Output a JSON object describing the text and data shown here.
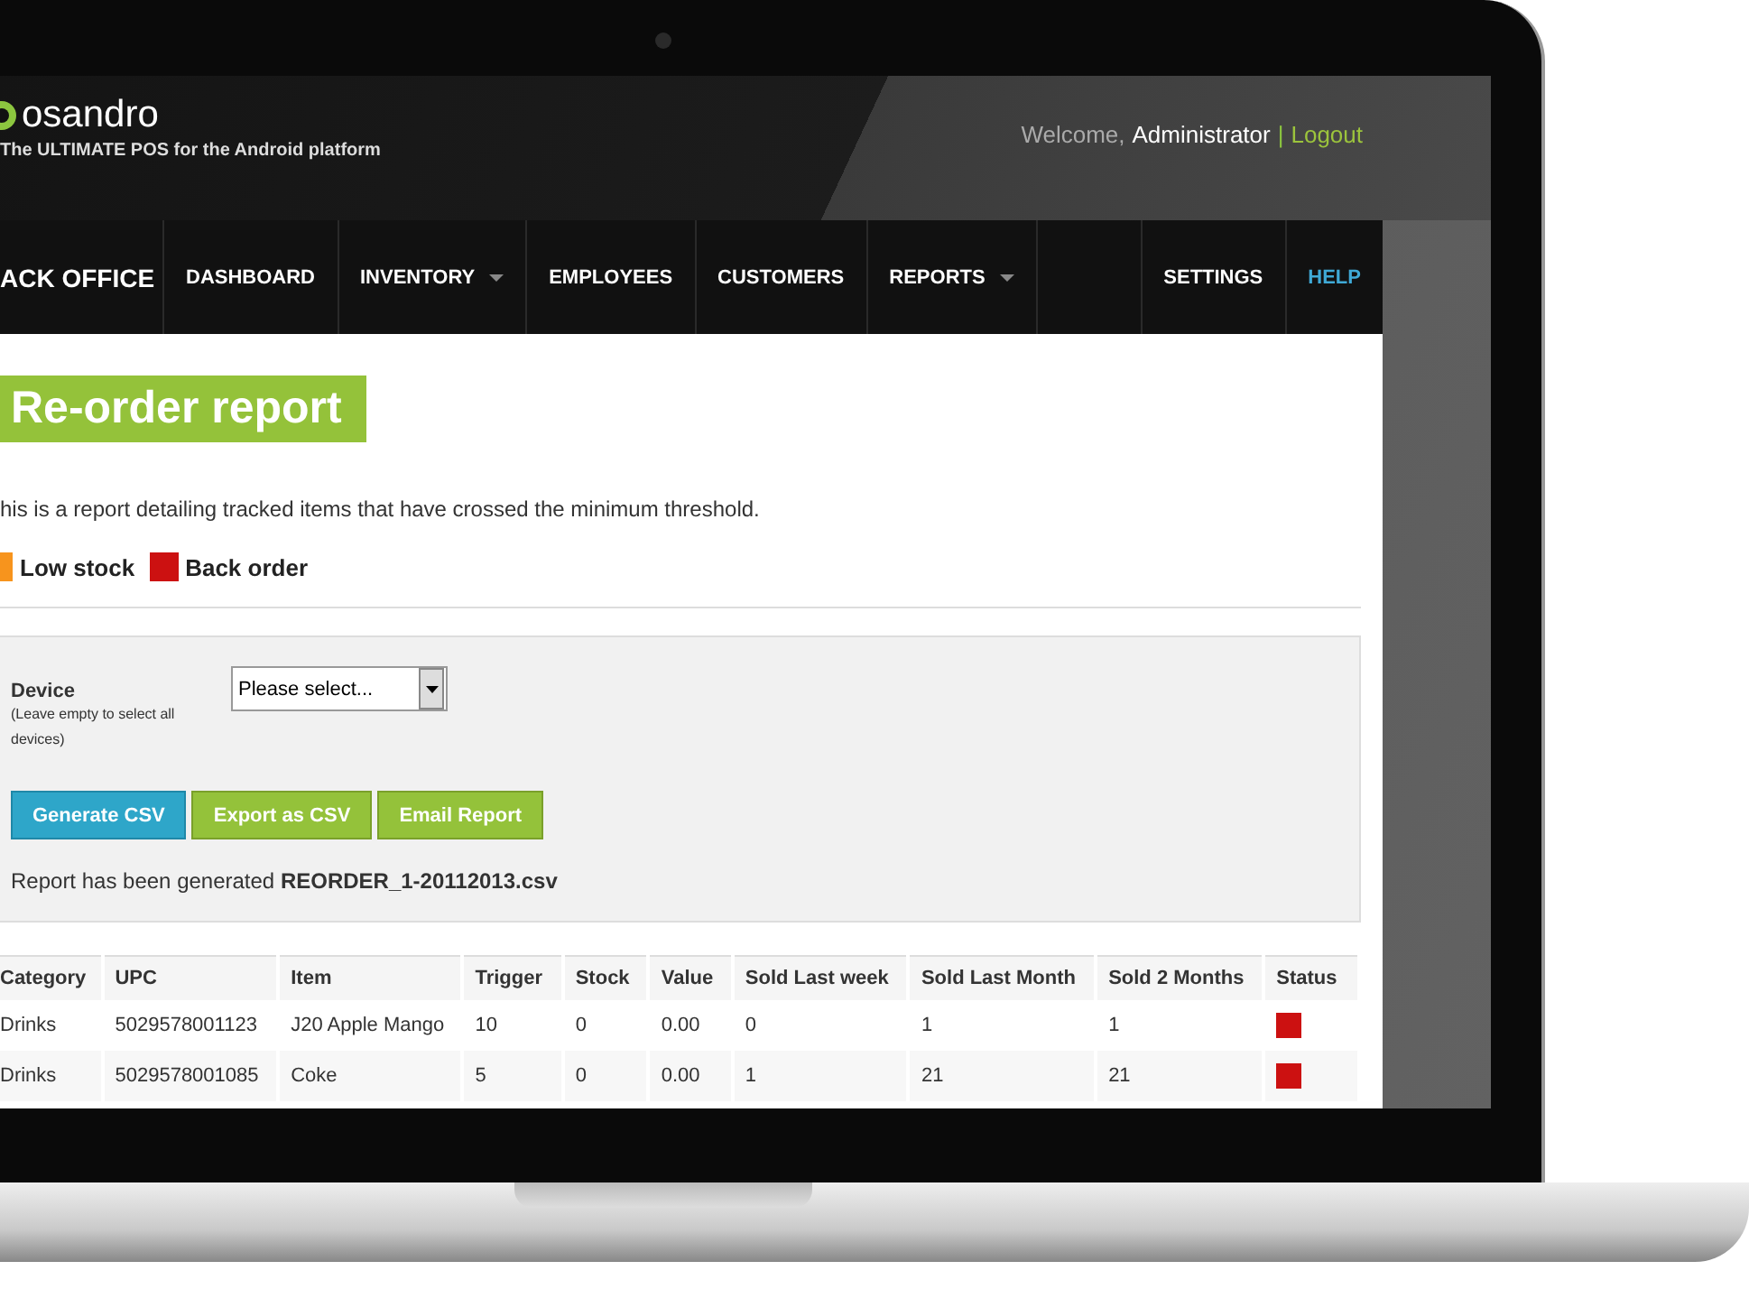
{
  "header": {
    "logo": "osandro",
    "tagline": "The ULTIMATE POS for the Android platform",
    "welcome": "Welcome,",
    "user": "Administrator",
    "separator": "|",
    "logout": "Logout"
  },
  "nav": {
    "brand": "ACK OFFICE",
    "items": [
      {
        "label": "DASHBOARD",
        "dropdown": false,
        "selected": false
      },
      {
        "label": "INVENTORY",
        "dropdown": true,
        "selected": false
      },
      {
        "label": "EMPLOYEES",
        "dropdown": false,
        "selected": false
      },
      {
        "label": "CUSTOMERS",
        "dropdown": false,
        "selected": false
      },
      {
        "label": "REPORTS",
        "dropdown": true,
        "selected": false
      }
    ],
    "right_items": [
      {
        "label": "SETTINGS",
        "selected": false
      },
      {
        "label": "HELP",
        "selected": true
      }
    ]
  },
  "page": {
    "title": "Re-order report",
    "description": "his is a report detailing tracked items that have crossed the minimum threshold.",
    "legend": [
      {
        "label": "Low stock",
        "color": "#f7941d"
      },
      {
        "label": "Back order",
        "color": "#cc1111"
      }
    ]
  },
  "form": {
    "device_label": "Device",
    "device_hint": "(Leave empty to select all devices)",
    "device_select": {
      "value": "Please select..."
    },
    "buttons": [
      {
        "label": "Generate CSV",
        "kind": "primary"
      },
      {
        "label": "Export as CSV",
        "kind": "secondary"
      },
      {
        "label": "Email Report",
        "kind": "secondary"
      }
    ],
    "message": "Report has been generated **REORDER_1-20112013.csv**"
  },
  "table": {
    "columns": [
      "Category",
      "UPC",
      "Item",
      "Trigger",
      "Stock",
      "Value",
      "Sold Last week",
      "Sold Last Month",
      "Sold 2 Months",
      "Status"
    ],
    "rows": [
      {
        "cells": [
          "Drinks",
          "5029578001123",
          "J20 Apple Mango",
          "10",
          "0",
          "0.00",
          "0",
          "1",
          "1"
        ],
        "color": "#cc1111"
      },
      {
        "cells": [
          "Drinks",
          "5029578001085",
          "Coke",
          "5",
          "0",
          "0.00",
          "1",
          "21",
          "21"
        ],
        "color": "#cc1111"
      }
    ]
  }
}
